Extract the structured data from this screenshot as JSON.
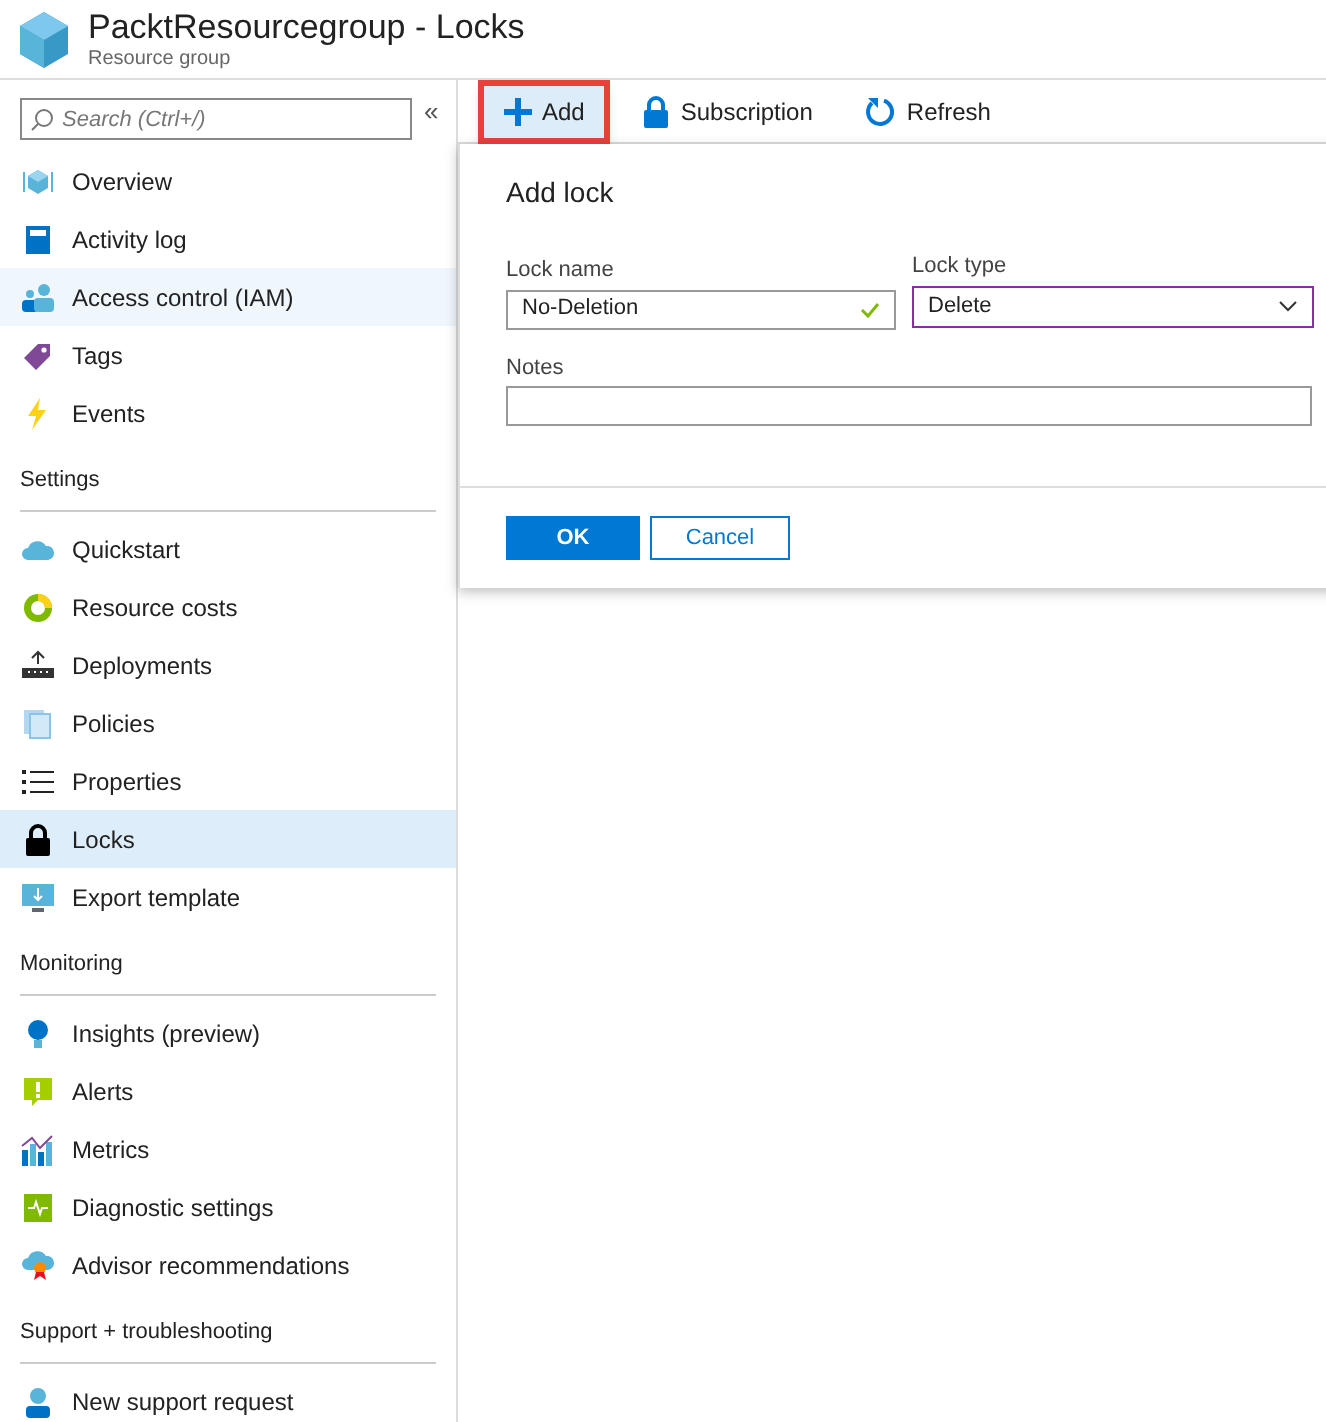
{
  "header": {
    "title": "PacktResourcegroup - Locks",
    "subtitle": "Resource group"
  },
  "sidebar": {
    "search": {
      "placeholder": "Search (Ctrl+/)"
    },
    "collapse": "«",
    "sections": [
      {
        "items": [
          {
            "label": "Overview",
            "selected": false,
            "hovered": false
          },
          {
            "label": "Activity log",
            "selected": false,
            "hovered": false
          },
          {
            "label": "Access control (IAM)",
            "selected": false,
            "hovered": true
          },
          {
            "label": "Tags",
            "selected": false,
            "hovered": false
          },
          {
            "label": "Events",
            "selected": false,
            "hovered": false
          }
        ]
      },
      {
        "heading": "Settings",
        "items": [
          {
            "label": "Quickstart",
            "selected": false,
            "hovered": false
          },
          {
            "label": "Resource costs",
            "selected": false,
            "hovered": false
          },
          {
            "label": "Deployments",
            "selected": false,
            "hovered": false
          },
          {
            "label": "Policies",
            "selected": false,
            "hovered": false
          },
          {
            "label": "Properties",
            "selected": false,
            "hovered": false
          },
          {
            "label": "Locks",
            "selected": true,
            "hovered": false
          },
          {
            "label": "Export template",
            "selected": false,
            "hovered": false
          }
        ]
      },
      {
        "heading": "Monitoring",
        "items": [
          {
            "label": "Insights (preview)",
            "selected": false,
            "hovered": false
          },
          {
            "label": "Alerts",
            "selected": false,
            "hovered": false
          },
          {
            "label": "Metrics",
            "selected": false,
            "hovered": false
          },
          {
            "label": "Diagnostic settings",
            "selected": false,
            "hovered": false
          },
          {
            "label": "Advisor recommendations",
            "selected": false,
            "hovered": false
          }
        ]
      },
      {
        "heading": "Support + troubleshooting",
        "items": [
          {
            "label": "New support request",
            "selected": false,
            "hovered": false
          }
        ]
      }
    ]
  },
  "toolbar": [
    {
      "label": "Add",
      "highlighted": true
    },
    {
      "label": "Subscription",
      "highlighted": false
    },
    {
      "label": "Refresh",
      "highlighted": false
    }
  ],
  "dialog": {
    "title": "Add lock",
    "lock_name": {
      "label": "Lock name",
      "value": "No-Deletion",
      "valid": true
    },
    "lock_type": {
      "label": "Lock type",
      "value": "Delete",
      "focused": true
    },
    "notes": {
      "label": "Notes"
    },
    "buttons": [
      {
        "label": "OK",
        "kind": "primary"
      },
      {
        "label": "Cancel",
        "kind": "secondary"
      }
    ]
  }
}
